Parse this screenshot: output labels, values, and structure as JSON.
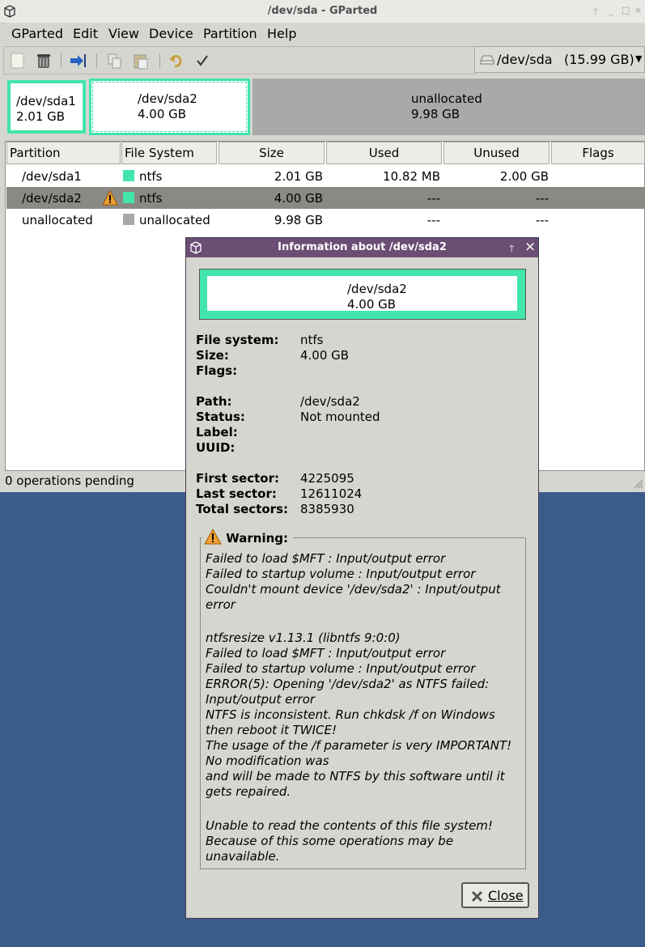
{
  "window": {
    "title": "/dev/sda - GParted"
  },
  "menubar": [
    "GParted",
    "Edit",
    "View",
    "Device",
    "Partition",
    "Help"
  ],
  "device_select": {
    "label": "/dev/sda",
    "size": "(15.99 GB)"
  },
  "diskmap": [
    {
      "name": "/dev/sda1",
      "size": "2.01 GB"
    },
    {
      "name": "/dev/sda2",
      "size": "4.00 GB"
    },
    {
      "name": "unallocated",
      "size": "9.98 GB"
    }
  ],
  "table": {
    "headers": [
      "Partition",
      "File System",
      "Size",
      "Used",
      "Unused",
      "Flags"
    ],
    "rows": [
      {
        "partition": "/dev/sda1",
        "fs": "ntfs",
        "size": "2.01 GB",
        "used": "10.82 MB",
        "unused": "2.00 GB",
        "flags": ""
      },
      {
        "partition": "/dev/sda2",
        "fs": "ntfs",
        "size": "4.00 GB",
        "used": "---",
        "unused": "---",
        "flags": ""
      },
      {
        "partition": "unallocated",
        "fs": "unallocated",
        "size": "9.98 GB",
        "used": "---",
        "unused": "---",
        "flags": ""
      }
    ]
  },
  "status": "0 operations pending",
  "colors": {
    "ntfs": "#42e5ac",
    "unallocated": "#a9a9a9",
    "selected_row": "#8b8984",
    "dialog_title": "#6b4e73",
    "desktop": "#3b5c89"
  },
  "dialog": {
    "title": "Information about /dev/sda2",
    "map_name": "/dev/sda2",
    "map_size": "4.00 GB",
    "fields": {
      "fs_label": "File system:",
      "fs_value": "ntfs",
      "size_label": "Size:",
      "size_value": "4.00 GB",
      "flags_label": "Flags:",
      "path_label": "Path:",
      "path_value": "/dev/sda2",
      "status_label": "Status:",
      "status_value": "Not mounted",
      "label_label": "Label:",
      "uuid_label": "UUID:",
      "first_label": "First sector:",
      "first_value": "4225095",
      "last_label": "Last sector:",
      "last_value": "12611024",
      "total_label": "Total sectors:",
      "total_value": "8385930"
    },
    "warning_title": "Warning:",
    "warning_lines": [
      "Failed to load $MFT : Input/output error",
      "Failed to startup volume : Input/output error",
      "Couldn't mount device '/dev/sda2' : Input/output",
      "error",
      "",
      "ntfsresize v1.13.1 (libntfs 9:0:0)",
      "Failed to load $MFT : Input/output error",
      "Failed to startup volume : Input/output error",
      "ERROR(5): Opening '/dev/sda2' as NTFS failed:",
      "Input/output error",
      "NTFS is inconsistent. Run chkdsk /f on Windows",
      "then reboot it TWICE!",
      "The usage of the /f parameter is very IMPORTANT!",
      "No modification was",
      "and will be made to NTFS by this software until it",
      "gets repaired.",
      "",
      "Unable to read the contents of this file system!",
      "Because of this some operations may be",
      "unavailable."
    ],
    "close_label": "Close"
  }
}
